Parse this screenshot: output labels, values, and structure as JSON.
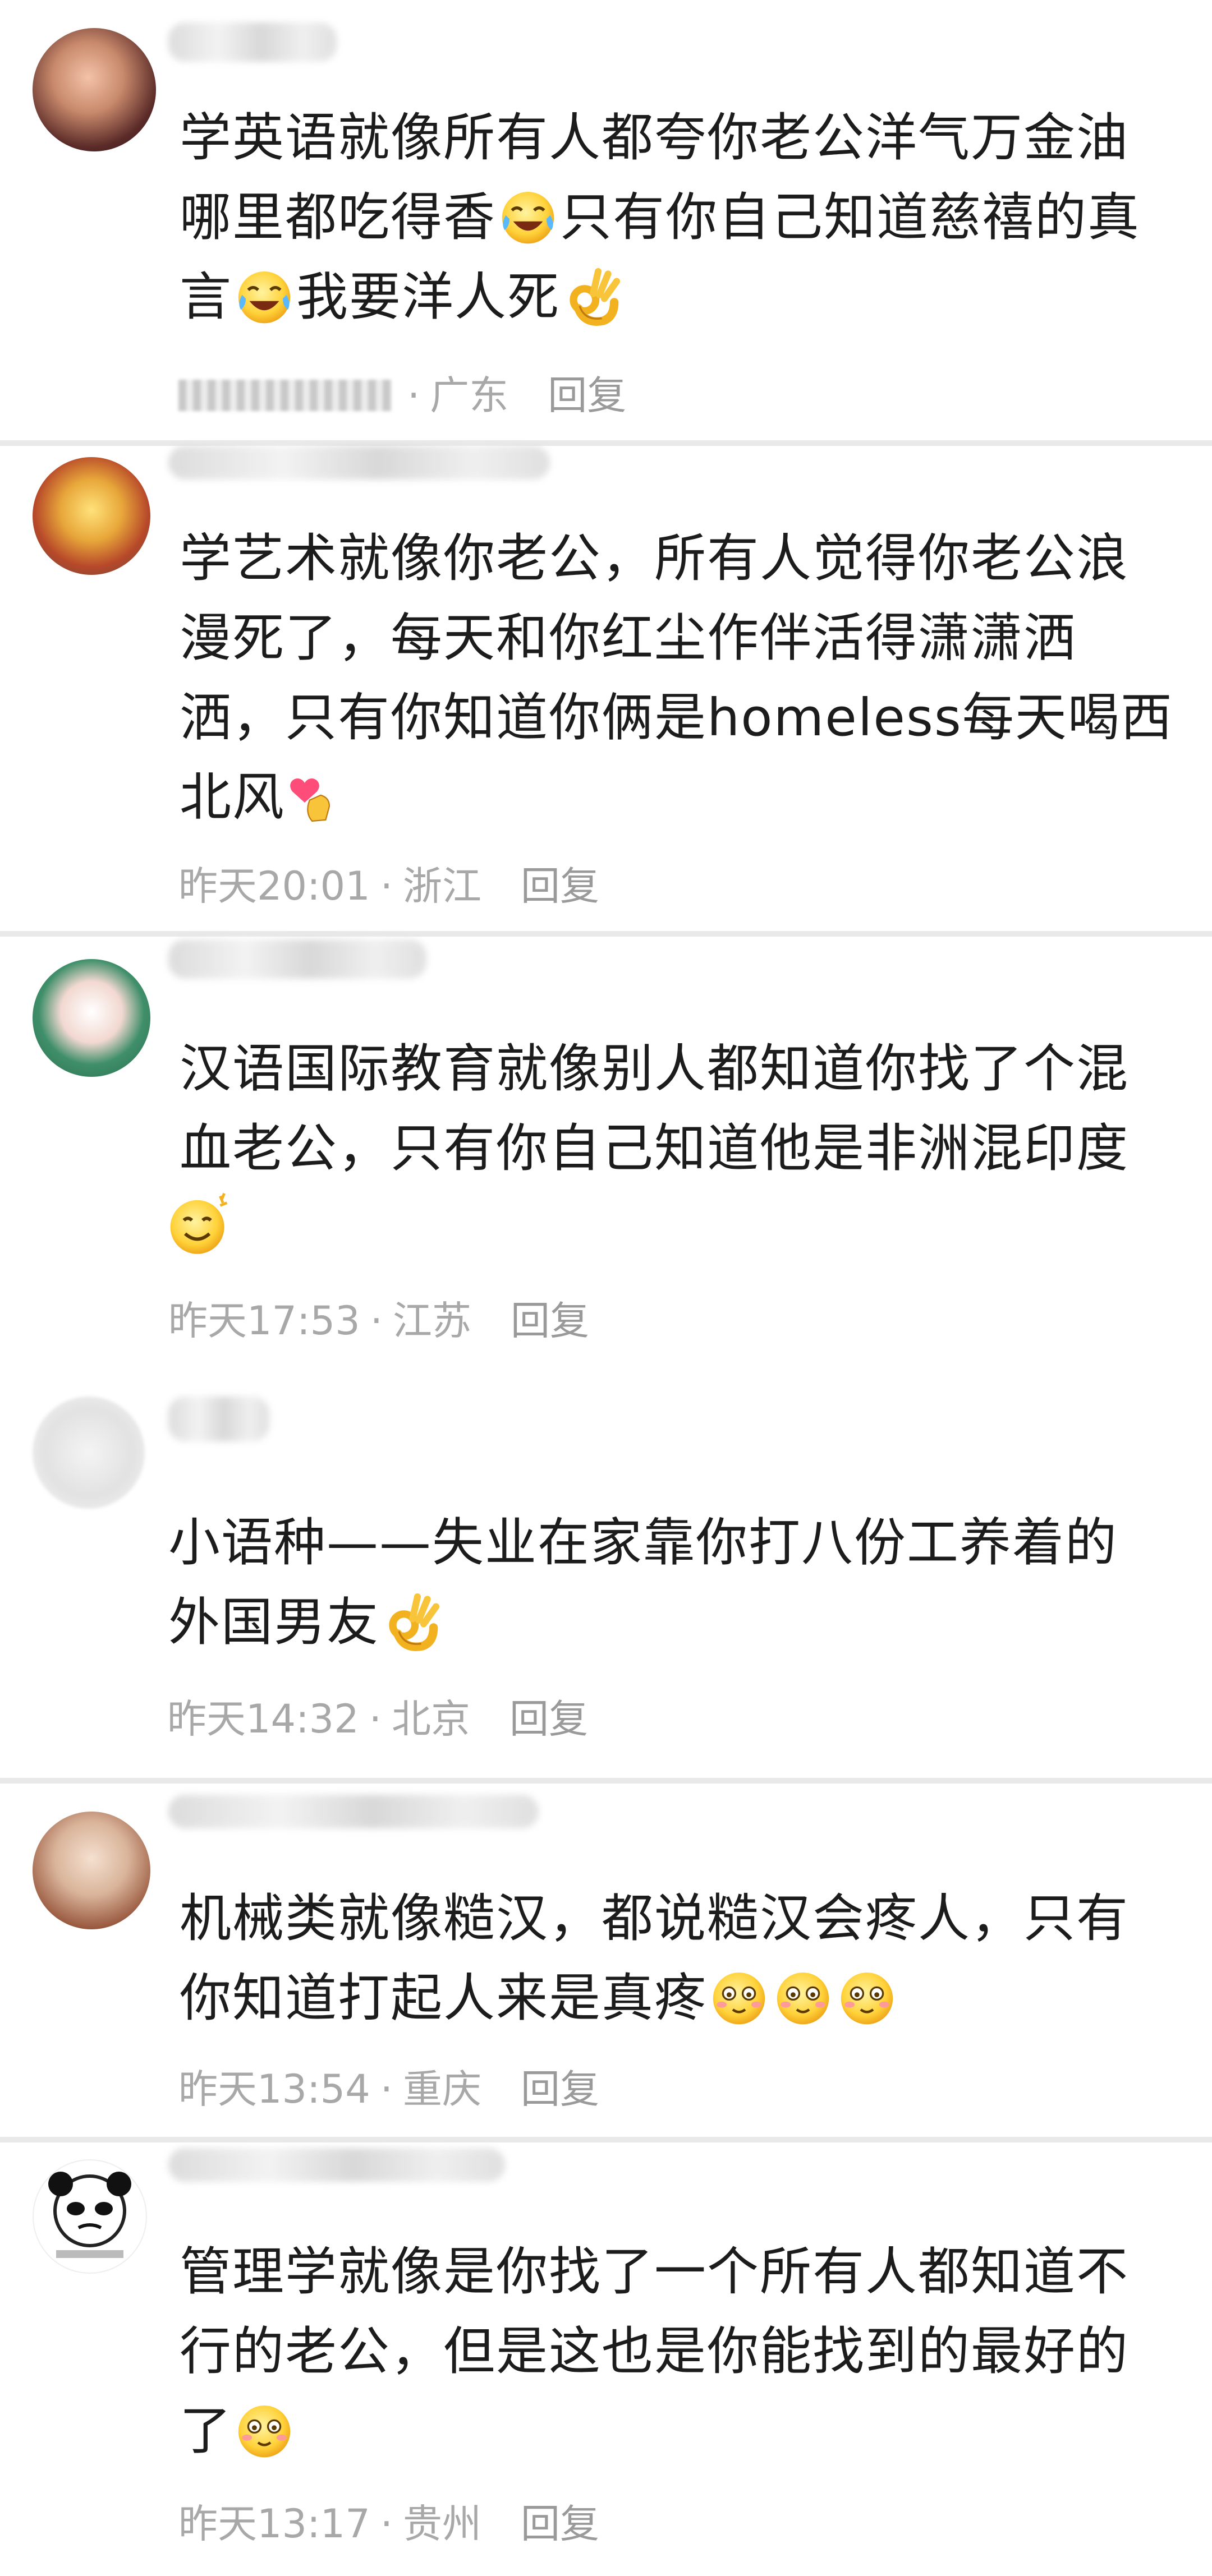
{
  "comments": [
    {
      "lines": [
        "学英语就像所有人都夸你老公洋气万金油",
        "哪里都吃得香",
        "只有你自己知道慈禧的真",
        "言",
        "我要洋人死"
      ],
      "line1": "学英语就像所有人都夸你老公洋气万金油",
      "line2a": "哪里都吃得香",
      "line2b": "只有你自己知道慈禧的真",
      "line3a": "言",
      "line3b": "我要洋人死",
      "time": "",
      "location": "广东",
      "reply": "回复",
      "emojis": [
        "laughing-tears-emoji",
        "laughing-tears-emoji",
        "ok-hand-emoji"
      ]
    },
    {
      "line1": "学艺术就像你老公，所有人觉得你老公浪",
      "line2": "漫死了，每天和你红尘作伴活得潇潇洒",
      "line3": "洒，只有你知道你俩是homeless每天喝西",
      "line4": "北风",
      "time": "昨天20:01",
      "location": "浙江",
      "reply": "回复",
      "emojis": [
        "finger-heart-emoji"
      ]
    },
    {
      "line1": "汉语国际教育就像别人都知道你找了个混",
      "line2": "血老公，只有你自己知道他是非洲混印度",
      "time": "昨天17:53",
      "location": "江苏",
      "reply": "回复",
      "emojis": [
        "smile-emoji"
      ]
    },
    {
      "line1": "小语种——失业在家靠你打八份工养着的",
      "line2": "外国男友",
      "time": "昨天14:32",
      "location": "北京",
      "reply": "回复",
      "emojis": [
        "ok-hand-emoji"
      ]
    },
    {
      "line1": "机械类就像糙汉，都说糙汉会疼人，只有",
      "line2": "你知道打起人来是真疼",
      "time": "昨天13:54",
      "location": "重庆",
      "reply": "回复",
      "emojis": [
        "blush-emoji",
        "blush-emoji",
        "blush-emoji"
      ]
    },
    {
      "line1": "管理学就像是你找了一个所有人都知道不",
      "line2": "行的老公，但是这也是你能找到的最好的",
      "line3": "了",
      "time": "昨天13:17",
      "location": "贵州",
      "reply": "回复",
      "emojis": [
        "blush-emoji"
      ]
    }
  ],
  "colors": {
    "meta": "#a8a8a8",
    "text": "#1c1c1c",
    "separator": "#e9e9e9"
  }
}
